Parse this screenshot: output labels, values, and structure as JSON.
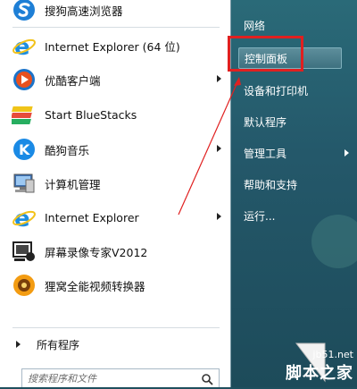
{
  "programs": [
    {
      "label": "搜狗高速浏览器",
      "icon": "sogou-browser-icon",
      "has_submenu": false
    },
    {
      "label": "Internet Explorer (64 位)",
      "icon": "internet-explorer-icon",
      "has_submenu": false
    },
    {
      "label": "优酷客户端",
      "icon": "youku-icon",
      "has_submenu": true
    },
    {
      "label": "Start BlueStacks",
      "icon": "bluestacks-icon",
      "has_submenu": false
    },
    {
      "label": "酷狗音乐",
      "icon": "kugou-music-icon",
      "has_submenu": true
    },
    {
      "label": "计算机管理",
      "icon": "computer-management-icon",
      "has_submenu": false
    },
    {
      "label": "Internet Explorer",
      "icon": "internet-explorer-icon",
      "has_submenu": true
    },
    {
      "label": "屏幕录像专家V2012",
      "icon": "screen-recorder-icon",
      "has_submenu": false
    },
    {
      "label": "狸窝全能视频转换器",
      "icon": "video-converter-icon",
      "has_submenu": false
    }
  ],
  "all_programs_label": "所有程序",
  "search": {
    "placeholder": "搜索程序和文件"
  },
  "right_items": [
    {
      "label": "网络",
      "has_submenu": false
    },
    {
      "label": "控制面板",
      "has_submenu": false,
      "highlighted": true
    },
    {
      "label": "设备和打印机",
      "has_submenu": false
    },
    {
      "label": "默认程序",
      "has_submenu": false
    },
    {
      "label": "管理工具",
      "has_submenu": true
    },
    {
      "label": "帮助和支持",
      "has_submenu": false
    },
    {
      "label": "运行...",
      "has_submenu": false
    }
  ],
  "annotation": {
    "color": "#e02020"
  },
  "watermark": {
    "url": "jb51.net",
    "name": "脚本之家"
  }
}
